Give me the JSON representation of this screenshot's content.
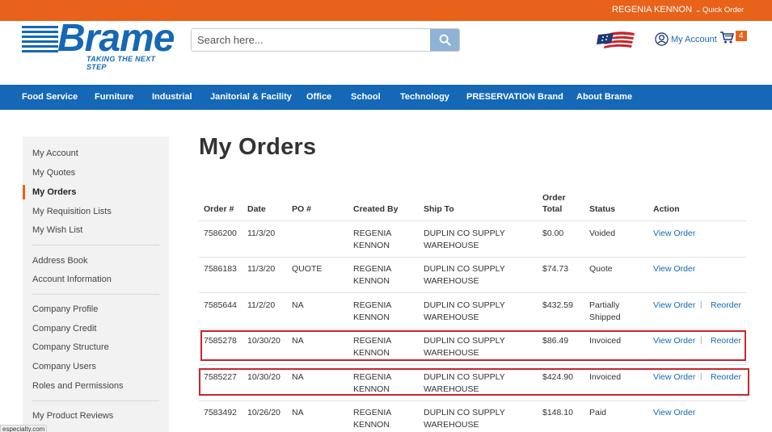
{
  "topbar": {
    "user_name": "REGENIA KENNON",
    "quick_order": "Quick Order"
  },
  "header": {
    "logo_text": "Brame",
    "logo_tagline": "TAKING THE NEXT STEP",
    "search_placeholder": "Search here...",
    "account_label": "My Account",
    "cart_count": "4"
  },
  "nav": [
    "Food Service",
    "Furniture",
    "Industrial",
    "Janitorial & Facility",
    "Office",
    "School",
    "Technology",
    "PRESERVATION Brand",
    "About Brame"
  ],
  "sidebar": {
    "group1": [
      "My Account",
      "My Quotes",
      "My Orders",
      "My Requisition Lists",
      "My Wish List"
    ],
    "group2": [
      "Address Book",
      "Account Information"
    ],
    "group3": [
      "Company Profile",
      "Company Credit",
      "Company Structure",
      "Company Users",
      "Roles and Permissions"
    ],
    "group4": [
      "My Product Reviews"
    ],
    "active": "My Orders"
  },
  "status_url": "especialty.com",
  "page_title": "My Orders",
  "table": {
    "headers": {
      "order": "Order #",
      "date": "Date",
      "po": "PO #",
      "created_by": "Created By",
      "ship_to": "Ship To",
      "total_line1": "Order",
      "total_line2": "Total",
      "status": "Status",
      "action": "Action"
    },
    "view_label": "View Order",
    "reorder_label": "Reorder",
    "rows": [
      {
        "order": "7586200",
        "date": "11/3/20",
        "po": "",
        "created_1": "REGENIA",
        "created_2": "KENNON",
        "ship_1": "DUPLIN CO SUPPLY",
        "ship_2": "WAREHOUSE",
        "total": "$0.00",
        "status_1": "Voided",
        "status_2": "",
        "reorder": false
      },
      {
        "order": "7586183",
        "date": "11/3/20",
        "po": "QUOTE",
        "created_1": "REGENIA",
        "created_2": "KENNON",
        "ship_1": "DUPLIN CO SUPPLY",
        "ship_2": "WAREHOUSE",
        "total": "$74.73",
        "status_1": "Quote",
        "status_2": "",
        "reorder": false
      },
      {
        "order": "7585644",
        "date": "11/2/20",
        "po": "NA",
        "created_1": "REGENIA",
        "created_2": "KENNON",
        "ship_1": "DUPLIN CO SUPPLY",
        "ship_2": "WAREHOUSE",
        "total": "$432.59",
        "status_1": "Partially",
        "status_2": "Shipped",
        "reorder": true
      },
      {
        "order": "7585278",
        "date": "10/30/20",
        "po": "NA",
        "created_1": "REGENIA",
        "created_2": "KENNON",
        "ship_1": "DUPLIN CO SUPPLY",
        "ship_2": "WAREHOUSE",
        "total": "$86.49",
        "status_1": "Invoiced",
        "status_2": "",
        "reorder": true
      },
      {
        "order": "7585227",
        "date": "10/30/20",
        "po": "NA",
        "created_1": "REGENIA",
        "created_2": "KENNON",
        "ship_1": "DUPLIN CO SUPPLY",
        "ship_2": "WAREHOUSE",
        "total": "$424.90",
        "status_1": "Invoiced",
        "status_2": "",
        "reorder": true
      },
      {
        "order": "7583492",
        "date": "10/26/20",
        "po": "NA",
        "created_1": "REGENIA",
        "created_2": "KENNON",
        "ship_1": "DUPLIN CO SUPPLY",
        "ship_2": "WAREHOUSE",
        "total": "$148.10",
        "status_1": "Paid",
        "status_2": "",
        "reorder": false
      }
    ]
  },
  "colors": {
    "brand_blue": "#1568b5",
    "accent_orange": "#e8621a",
    "highlight_red": "#c8252c"
  }
}
